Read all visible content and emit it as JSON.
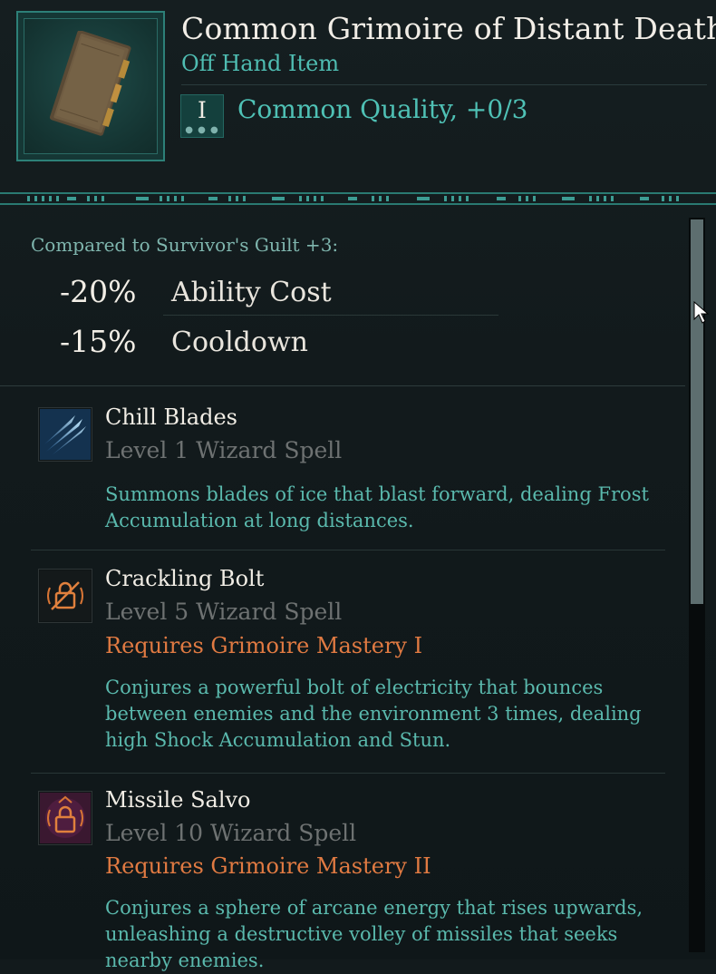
{
  "item": {
    "name": "Common Grimoire of Distant Death",
    "type": "Off Hand Item",
    "tier_numeral": "I",
    "tier_dots": "● ● ●",
    "quality": "Common Quality, +0/3",
    "icon": "grimoire-book-icon"
  },
  "comparison": {
    "header": "Compared to Survivor's Guilt +3:",
    "stats": [
      {
        "value": "-20%",
        "label": "Ability Cost"
      },
      {
        "value": "-15%",
        "label": "Cooldown"
      }
    ]
  },
  "skills": [
    {
      "name": "Chill Blades",
      "level": "Level 1 Wizard Spell",
      "requirement": "",
      "description": "Summons blades of ice that blast forward, dealing Frost Accumulation at long distances.",
      "icon": "chill-blades-icon"
    },
    {
      "name": "Crackling Bolt",
      "level": "Level 5 Wizard Spell",
      "requirement": "Requires Grimoire Mastery I",
      "description": "Conjures a powerful bolt of electricity that bounces between enemies and the environment 3 times, dealing high Shock Accumulation and Stun.",
      "icon": "locked-bolt-icon"
    },
    {
      "name": "Missile Salvo",
      "level": "Level 10 Wizard Spell",
      "requirement": "Requires Grimoire Mastery II",
      "description": "Conjures a sphere of arcane energy that rises upwards, unleashing a destructive volley of missiles that seeks nearby enemies.",
      "icon": "locked-missile-icon"
    }
  ],
  "colors": {
    "accent_teal": "#4fc1b5",
    "requirement_orange": "#e07a42",
    "background": "#121a1c"
  }
}
